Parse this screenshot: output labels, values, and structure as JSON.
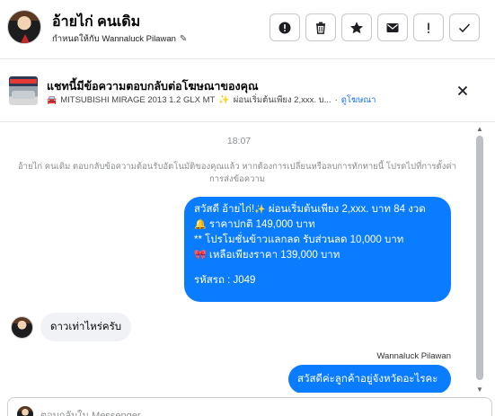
{
  "header": {
    "contact_name": "อ้ายไก่ คนเดิม",
    "assign_label": "กำหนดให้กับ Wannaluck Pilawan"
  },
  "toolbar": {
    "buttons": [
      {
        "name": "mark-spam-button",
        "icon": "alert-circle-icon"
      },
      {
        "name": "delete-button",
        "icon": "trash-icon"
      },
      {
        "name": "star-button",
        "icon": "star-icon"
      },
      {
        "name": "mark-unread-button",
        "icon": "envelope-icon"
      },
      {
        "name": "follow-up-button",
        "icon": "exclamation-icon"
      },
      {
        "name": "done-button",
        "icon": "checkmark-icon"
      }
    ]
  },
  "ad_banner": {
    "title": "แชทนี้มีข้อความตอบกลับต่อโฆษณาของคุณ",
    "ad_name": "MITSUBISHI MIRAGE 2013 1.2 GLX MT",
    "ad_snippet": "ผ่อนเริ่มต้นเพียง 2,xxx. บ...",
    "separator": "·",
    "view_ad_link": "ดูโฆษณา"
  },
  "chat": {
    "timestamp": "18:07",
    "system_message": "อ้ายไก่ คนเดิม ตอบกลับข้อความต้อนรับอัตโนมัติของคุณแล้ว หากต้องการเปลี่ยนหรือลบการทักทายนี้ โปรดไปที่การตั้งค่าการส่งข้อความ",
    "outgoing_main": {
      "line1": "สวัสดี อ้ายไก่!",
      "line1b": "ผ่อนเริ่มต้นเพียง 2,xxx. บาท 84 งวด",
      "line2": "ราคาปกติ 149,000 บาท",
      "line3": "** โปรโมชั่นข้าวแลกลด รับส่วนลด 10,000 บาท",
      "line4": "เหลือเพียงราคา 139,000 บาท",
      "code": "รหัสรถ : J049"
    },
    "incoming_message": "ดาวเท่าไหร่ครับ",
    "sender_name": "Wannaluck Pilawan",
    "outgoing_reply": "สวัสดีค่ะลูกค้าอยู่จังหวัดอะไรคะ"
  },
  "composer": {
    "placeholder": "ตอบกลับใน Messenger..."
  },
  "colors": {
    "bubble_out": "#0a7cff",
    "bubble_in": "#f0f2f5",
    "link": "#1a73e8"
  }
}
